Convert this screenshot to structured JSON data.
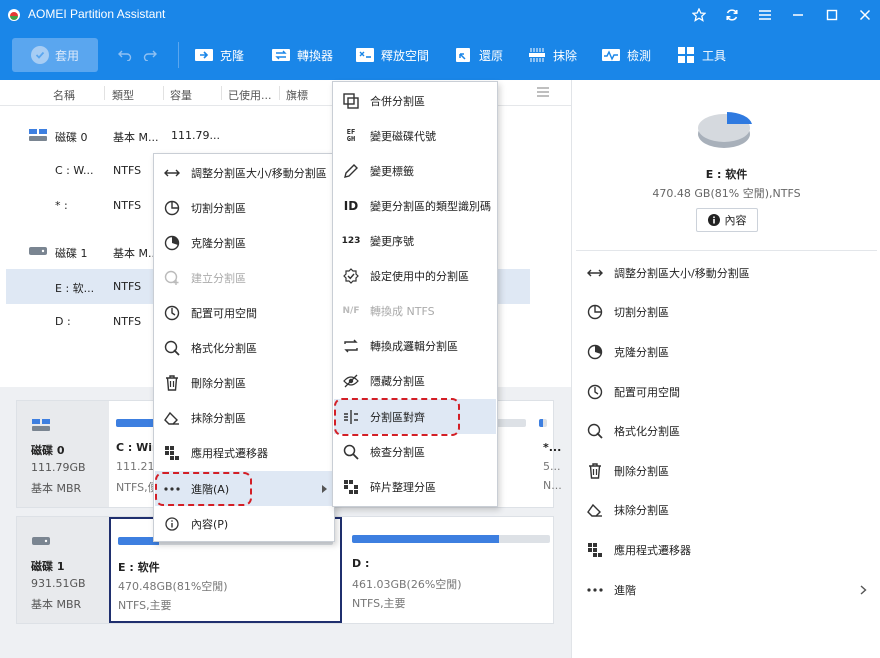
{
  "app": {
    "title": "AOMEI Partition Assistant"
  },
  "toolbar": {
    "apply": "套用",
    "items": [
      "克隆",
      "轉換器",
      "釋放空間",
      "還原",
      "抹除",
      "檢測",
      "工具"
    ]
  },
  "list": {
    "headers": [
      "名稱",
      "類型",
      "容量",
      "已使用...",
      "旗標"
    ],
    "rows": [
      {
        "name": "磁碟 0",
        "type": "基本 M...",
        "cap": "111.79..."
      },
      {
        "name": "C : W...",
        "type": "NTFS",
        "cap": ""
      },
      {
        "name": "* :",
        "type": "NTFS",
        "cap": ""
      },
      {
        "name": "磁碟 1",
        "type": "基本 M...",
        "cap": ""
      },
      {
        "name": "E : 软...",
        "type": "NTFS",
        "cap": ""
      },
      {
        "name": "D :",
        "type": "NTFS",
        "cap": ""
      }
    ]
  },
  "disks": [
    {
      "name": "磁碟 0",
      "size": "111.79GB",
      "style": "基本 MBR",
      "parts": [
        {
          "name": "C : Win",
          "size": "111.21G",
          "fs": "NTFS,便",
          "used": 0.55
        },
        {
          "name": "*...",
          "size": "5...",
          "fs": "N...",
          "used": 0.5
        }
      ]
    },
    {
      "name": "磁碟 1",
      "size": "931.51GB",
      "style": "基本 MBR",
      "parts": [
        {
          "name": "E : 软件",
          "size": "470.48GB(81%空閒)",
          "fs": "NTFS,主要",
          "used": 0.19
        },
        {
          "name": "D :",
          "size": "461.03GB(26%空閒)",
          "fs": "NTFS,主要",
          "used": 0.74
        }
      ]
    }
  ],
  "right": {
    "title": "E : 软件",
    "subtitle": "470.48 GB(81% 空閒),NTFS",
    "props_btn": "內容",
    "items": [
      "調整分割區大小/移動分割區",
      "切割分割區",
      "克隆分割區",
      "配置可用空間",
      "格式化分割區",
      "刪除分割區",
      "抹除分割區",
      "應用程式遷移器",
      "進階"
    ]
  },
  "menu1": {
    "items": [
      "調整分割區大小/移動分割區",
      "切割分割區",
      "克隆分割區",
      "建立分割區",
      "配置可用空間",
      "格式化分割區",
      "刪除分割區",
      "抹除分割區",
      "應用程式遷移器",
      "進階(A)",
      "內容(P)"
    ]
  },
  "menu2": {
    "items": [
      "合併分割區",
      "變更磁碟代號",
      "變更標籤",
      "變更分割區的類型識別碼",
      "變更序號",
      "設定使用中的分割區",
      "轉換成 NTFS",
      "轉換成邏輯分割區",
      "隱藏分割區",
      "分割區對齊",
      "檢查分割區",
      "碎片整理分區"
    ]
  },
  "colors": {
    "accent": "#1a86e8",
    "highlight": "#d31f26",
    "select": "#dfe8f4"
  }
}
